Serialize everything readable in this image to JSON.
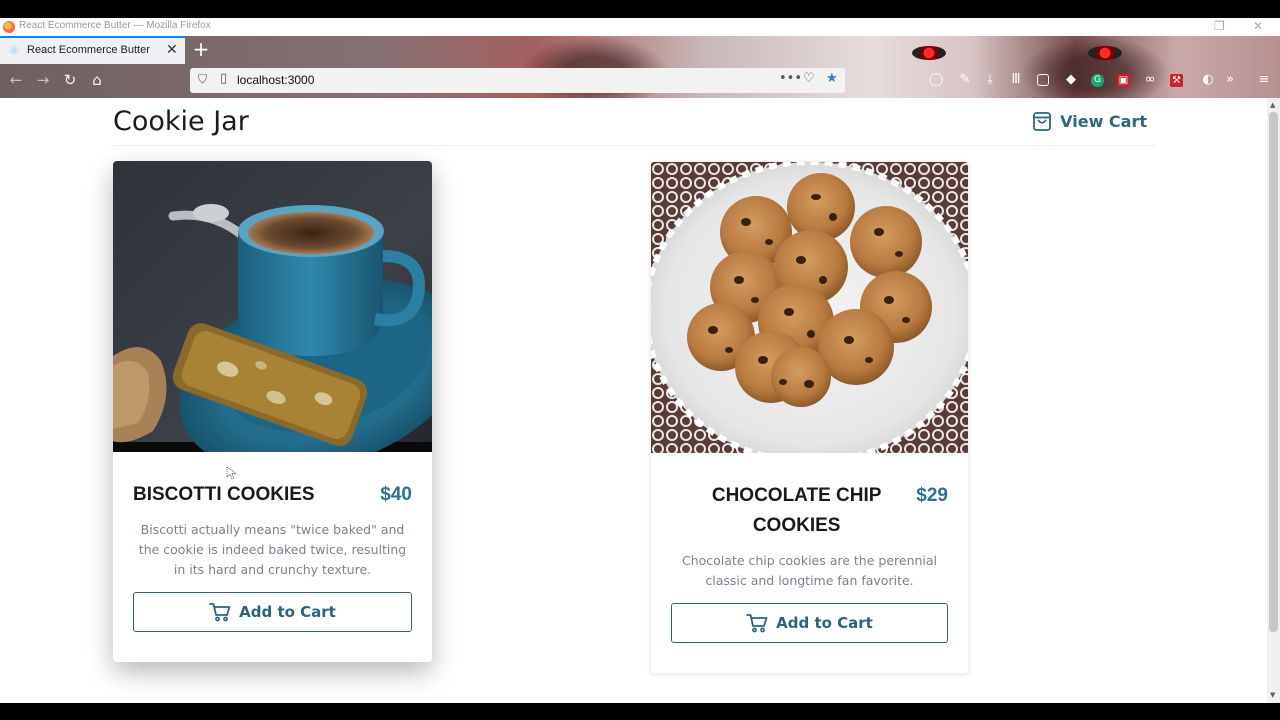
{
  "window": {
    "title": "React Ecommerce Butter — Mozilla Firefox"
  },
  "tab": {
    "label": "React Ecommerce Butter",
    "close": "✕",
    "new_tab": "+"
  },
  "address_bar": {
    "url": "localhost:3000",
    "menu_glyph": "•••"
  },
  "store": {
    "brand": "Cookie Jar",
    "view_cart_label": "View Cart"
  },
  "products": [
    {
      "name": "BISCOTTI COOKIES",
      "price": "$40",
      "description": "Biscotti actually means \"twice baked\" and the cookie is indeed baked twice, resulting in its hard and crunchy texture.",
      "button_label": "Add to Cart"
    },
    {
      "name": "CHOCOLATE CHIP COOKIES",
      "price": "$29",
      "description": "Chocolate chip cookies are the perennial classic and longtime fan favorite.",
      "button_label": "Add to Cart"
    }
  ],
  "colors": {
    "accent": "#31657a",
    "price": "#2d7390",
    "browser_active_tab": "#0a84ff"
  }
}
